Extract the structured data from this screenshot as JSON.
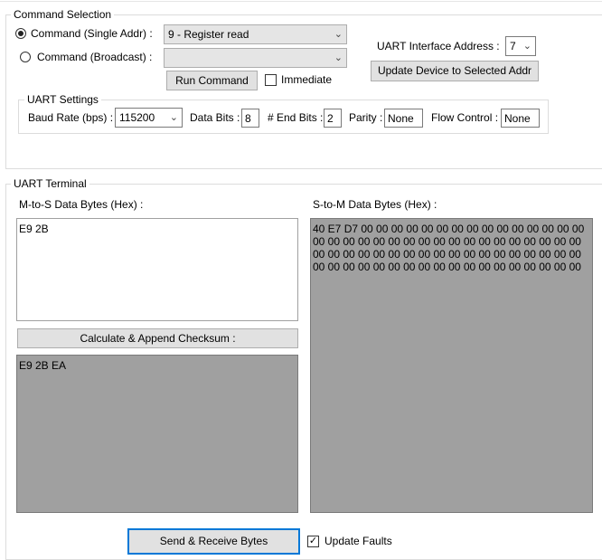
{
  "command_selection": {
    "legend": "Command Selection",
    "single_addr_label": "Command (Single Addr) :",
    "single_addr_selected": "9 - Register read",
    "broadcast_label": "Command (Broadcast) :",
    "broadcast_selected": "",
    "run_command_label": "Run Command",
    "immediate_label": "Immediate",
    "immediate_checked": false,
    "uart_address_label": "UART Interface Address :",
    "uart_address_value": "7",
    "update_device_label": "Update Device to Selected Addr"
  },
  "uart_settings": {
    "legend": "UART Settings",
    "baud_label": "Baud Rate (bps) :",
    "baud_value": "115200",
    "data_bits_label": "Data Bits :",
    "data_bits_value": "8",
    "end_bits_label": "# End Bits :",
    "end_bits_value": "2",
    "parity_label": "Parity :",
    "parity_value": "None",
    "flow_label": "Flow Control :",
    "flow_value": "None"
  },
  "uart_terminal": {
    "legend": "UART Terminal",
    "m_to_s_label": "M-to-S Data Bytes (Hex) :",
    "m_to_s_value": "E9 2B",
    "checksum_button_label": "Calculate & Append Checksum :",
    "checksum_value": "E9 2B EA",
    "s_to_m_label": "S-to-M Data Bytes (Hex) :",
    "s_to_m_value": "40 E7 D7 00 00 00 00 00 00 00 00 00 00 00 00 00 00 00 00 00 00 00 00 00 00 00 00 00 00 00 00 00 00 00 00 00 00 00 00 00 00 00 00 00 00 00 00 00 00 00 00 00 00 00 00 00 00 00 00 00 00 00 00 00 00 00 00 00 00 00 00 00",
    "send_receive_label": "Send & Receive Bytes",
    "update_faults_label": "Update Faults",
    "update_faults_checked": true
  },
  "icons": {
    "dropdown": "chevron-down-icon",
    "checkmark": "✓"
  }
}
